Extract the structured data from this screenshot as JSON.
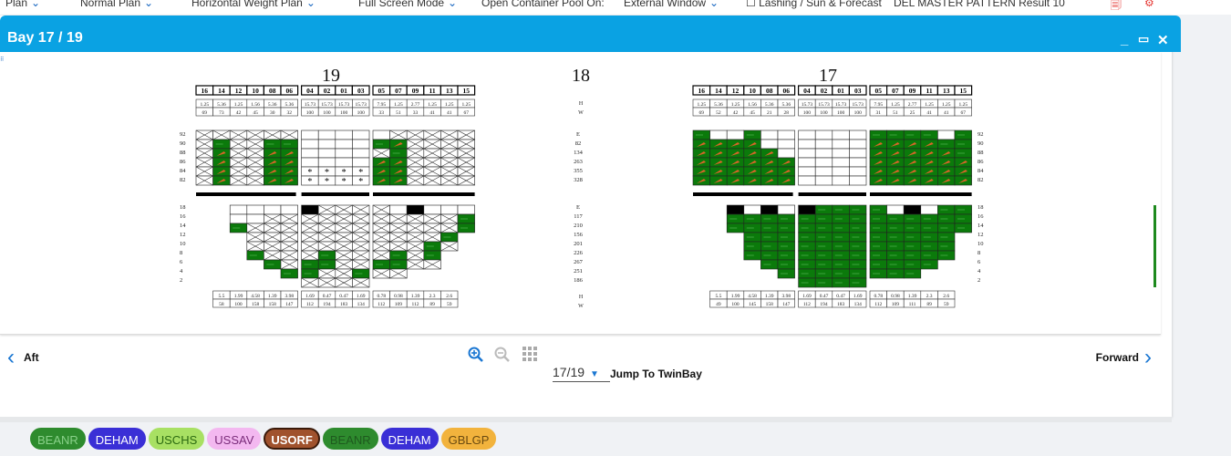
{
  "topbar": {
    "items": [
      "Plan",
      "Normal Plan",
      "Horizontal Weight Plan",
      "Full Screen Mode",
      "Open Container Pool On:",
      "External Window",
      "Lashing / Sun & Forecast",
      "DEL MASTER PATTERN Result 10"
    ]
  },
  "window": {
    "title": "Bay 17 / 19",
    "minimize": "_",
    "restore": "▭",
    "close": "✕"
  },
  "bays": {
    "left_label": "19",
    "middle_label": "18",
    "right_label": "17",
    "row_numbers": [
      "16",
      "14",
      "12",
      "10",
      "08",
      "06",
      "04",
      "02",
      "01",
      "03",
      "05",
      "07",
      "09",
      "11",
      "13",
      "15"
    ],
    "row_values_left": [
      "1.25",
      "5.36",
      "1.25",
      "1.56",
      "5.36",
      "5.36",
      "15.73",
      "15.73",
      "15.73",
      "15.73",
      "7.95",
      "1.25",
      "2.77",
      "1.25",
      "1.25",
      "1.25"
    ],
    "row_counts_left": [
      "69",
      "73",
      "42",
      "45",
      "30",
      "32",
      "100",
      "100",
      "100",
      "100",
      "33",
      "51",
      "33",
      "41",
      "41",
      "67"
    ],
    "row_values_right": [
      "1.25",
      "5.36",
      "1.25",
      "1.56",
      "5.36",
      "5.36",
      "15.73",
      "15.73",
      "15.73",
      "15.73",
      "7.95",
      "1.25",
      "2.77",
      "1.25",
      "1.25",
      "1.25"
    ],
    "row_counts_right": [
      "69",
      "52",
      "42",
      "45",
      "21",
      "28",
      "100",
      "100",
      "100",
      "100",
      "31",
      "51",
      "25",
      "41",
      "41",
      "67"
    ],
    "deck_tiers": [
      "92",
      "90",
      "88",
      "86",
      "84",
      "82"
    ],
    "deck_center": [
      "E",
      "82",
      "134",
      "263",
      "355",
      "328"
    ],
    "hold_tiers": [
      "18",
      "16",
      "14",
      "12",
      "10",
      "8",
      "6",
      "4",
      "2"
    ],
    "hold_center": [
      "E",
      "117",
      "210",
      "156",
      "201",
      "226",
      "267",
      "251",
      "186"
    ],
    "bottom_vals_left": [
      "5.5",
      "1.99",
      "4.58",
      "1.39",
      "3.98",
      "1.69",
      "0.47",
      "0.47",
      "1.69",
      "0.78",
      "0.98",
      "1.39",
      "2.3",
      "2.6"
    ],
    "bottom_counts_left": [
      "58",
      "100",
      "158",
      "158",
      "147",
      "112",
      "194",
      "183",
      "134",
      "112",
      "109",
      "112",
      "89",
      "59"
    ],
    "bottom_vals_right": [
      "5.5",
      "1.99",
      "4.58",
      "1.39",
      "3.98",
      "1.69",
      "0.47",
      "0.47",
      "1.69",
      "0.78",
      "0.98",
      "1.39",
      "2.3",
      "2.6"
    ],
    "bottom_counts_right": [
      "49",
      "100",
      "145",
      "158",
      "147",
      "112",
      "194",
      "183",
      "134",
      "112",
      "109",
      "111",
      "89",
      "59"
    ],
    "hw_top": "H",
    "hw_bottom": "W",
    "star": "*"
  },
  "nav": {
    "aft": "Aft",
    "forward": "Forward",
    "bay_value": "17/19",
    "jump": "Jump To TwinBay",
    "icons": [
      "zoom-in-icon",
      "zoom-out-icon",
      "grid-icon"
    ]
  },
  "ports": [
    {
      "label": "BEANR",
      "bg": "#2e8b2e",
      "fg": "#8ad18a",
      "border": "#2e8b2e"
    },
    {
      "label": "DEHAM",
      "bg": "#3a2fd6",
      "fg": "#ffffff",
      "border": "#3a2fd6"
    },
    {
      "label": "USCHS",
      "bg": "#a8e063",
      "fg": "#2b6a10",
      "border": "#a8e063"
    },
    {
      "label": "USSAV",
      "bg": "#f3b8f0",
      "fg": "#7a2b7a",
      "border": "#f3b8f0"
    },
    {
      "label": "USORF",
      "bg": "#a0522d",
      "fg": "#ffffff",
      "border": "#3a1a0a"
    },
    {
      "label": "BEANR",
      "bg": "#2e8b2e",
      "fg": "#1e5a1e",
      "border": "#2e8b2e"
    },
    {
      "label": "DEHAM",
      "bg": "#3a2fd6",
      "fg": "#ffffff",
      "border": "#3a2fd6"
    },
    {
      "label": "GBLGP",
      "bg": "#f2b33d",
      "fg": "#6a4a10",
      "border": "#f2b33d"
    }
  ]
}
